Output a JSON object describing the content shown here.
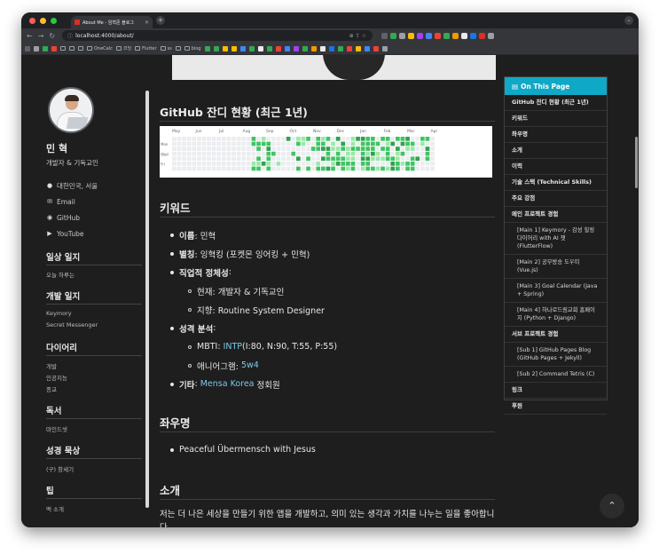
{
  "browser": {
    "tab_title": "About Me - 임혁준 블로그",
    "url": "localhost:4000/about/",
    "bookmarks": [
      "OneCalc",
      "코딩",
      "Flutter",
      "ss",
      "blog"
    ]
  },
  "sidebar": {
    "name": "민 혁",
    "role": "개발자 & 기독교인",
    "links": [
      {
        "icon": "location-pin-icon",
        "label": "대한민국, 서울"
      },
      {
        "icon": "email-icon",
        "label": "Email"
      },
      {
        "icon": "github-icon",
        "label": "GitHub"
      },
      {
        "icon": "youtube-icon",
        "label": "YouTube"
      }
    ],
    "categories": [
      {
        "title": "일상 일지",
        "items": [
          "오늘 하루는"
        ]
      },
      {
        "title": "개발 일지",
        "items": [
          "Keymory",
          "Secret Messenger"
        ]
      },
      {
        "title": "다이어리",
        "items": [
          "개발",
          "인공지능",
          "종교"
        ]
      },
      {
        "title": "독서",
        "items": [
          "마인드셋"
        ]
      },
      {
        "title": "성경 묵상",
        "items": [
          "(구) 창세기"
        ]
      },
      {
        "title": "팁",
        "items": [
          "맥 소개"
        ]
      }
    ]
  },
  "main": {
    "heatmap_title": "GitHub 잔디 현황 (최근 1년)",
    "heatmap_months": [
      "May",
      "Jun",
      "Jul",
      "Aug",
      "Sep",
      "Oct",
      "Nov",
      "Dec",
      "Jan",
      "Feb",
      "Mar",
      "Apr"
    ],
    "heatmap_days": [
      "Mon",
      "Wed",
      "Fri"
    ],
    "keywords_title": "키워드",
    "keywords": {
      "name_label": "이름",
      "name_value": ": 민혁",
      "alias_label": "별칭",
      "alias_value": ": 잉혁킹 (포켓몬 잉어킹 + 민혁)",
      "identity_label": "직업적 정체성",
      "identity_colon": ":",
      "identity_now": "현재: 개발자 & 기독교인",
      "identity_goal": "지향: Routine System Designer",
      "personality_label": "성격 분석",
      "personality_colon": ":",
      "mbti_prefix": "MBTI: ",
      "mbti_link": "INTP",
      "mbti_rest": " (I:80, N:90, T:55, P:55)",
      "enneagram_prefix": "애니어그램: ",
      "enneagram_link": "5w4",
      "etc_label": "기타",
      "etc_colon": ": ",
      "etc_link": "Mensa Korea",
      "etc_rest": " 정회원"
    },
    "motto_title": "좌우명",
    "motto": "Peaceful Übermensch with Jesus",
    "intro_title": "소개",
    "intro_text": "저는 더 나은 세상을 만들기 위한 앱을 개발하고, 의미 있는 생각과 가치를 나누는 일을 좋아합니다."
  },
  "toc": {
    "header": "On This Page",
    "items": [
      {
        "label": "GitHub 잔디 현황 (최근 1년)",
        "level": 1
      },
      {
        "label": "키워드",
        "level": 1
      },
      {
        "label": "좌우명",
        "level": 1
      },
      {
        "label": "소개",
        "level": 1
      },
      {
        "label": "이력",
        "level": 1
      },
      {
        "label": "기술 스택 (Technical Skills)",
        "level": 1
      },
      {
        "label": "주요 강점",
        "level": 1
      },
      {
        "label": "메인 프로젝트 경험",
        "level": 1
      },
      {
        "label": "[Main 1] Keymory - 감성 힐링 다이어리 with AI 챗 (FlutterFlow)",
        "level": 2
      },
      {
        "label": "[Main 2] 공부방송 도우미 (Vue.js)",
        "level": 2
      },
      {
        "label": "[Main 3] Goal Calendar (Java + Spring)",
        "level": 2
      },
      {
        "label": "[Main 4] 하나로드림교회 홈페이지 (Python + Django)",
        "level": 2
      },
      {
        "label": "서브 프로젝트 경험",
        "level": 1
      },
      {
        "label": "[Sub 1] GitHub Pages Blog (GitHub Pages + Jekyll)",
        "level": 2
      },
      {
        "label": "[Sub 2] Command Tetris (C)",
        "level": 2
      },
      {
        "label": "링크",
        "level": 1
      },
      {
        "label": "후원",
        "level": 1
      }
    ]
  },
  "colors": {
    "accent": "#0fa8c6",
    "link": "#7cc8e8",
    "heat_low": "#9be9a8",
    "heat_mid": "#40c463",
    "heat_high": "#30a14e"
  }
}
